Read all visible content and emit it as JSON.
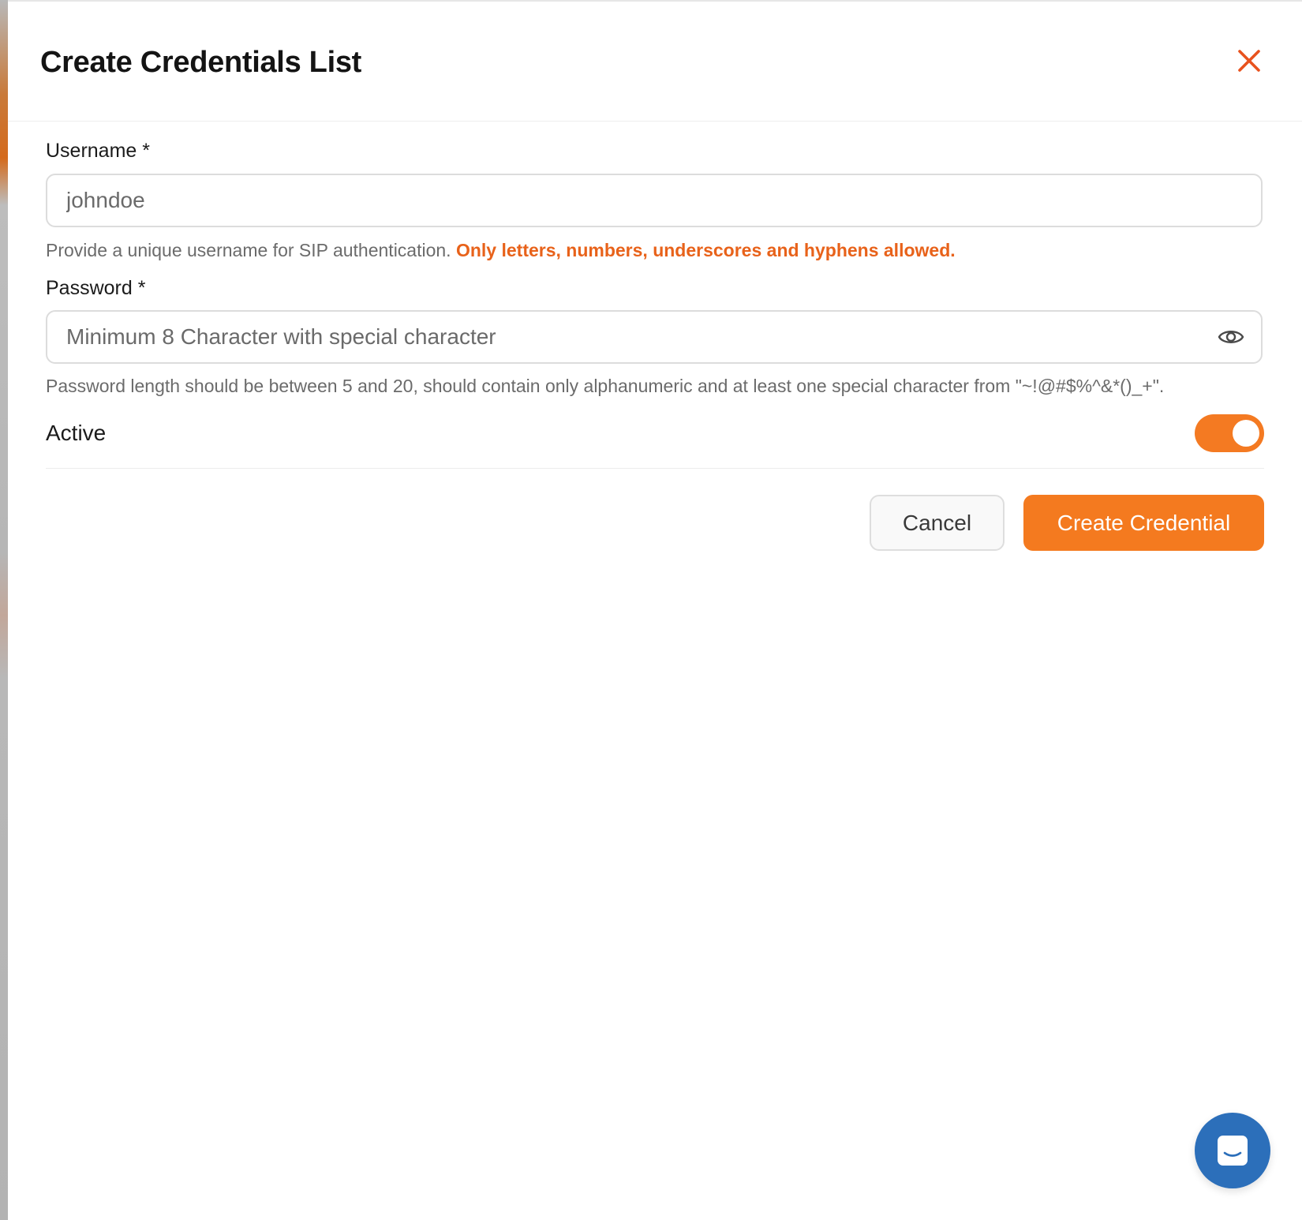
{
  "modal": {
    "title": "Create Credentials List"
  },
  "username": {
    "label": "Username *",
    "placeholder": "johndoe",
    "help": "Provide a unique username for SIP authentication.",
    "help_warning": "Only letters, numbers, underscores and hyphens allowed."
  },
  "password": {
    "label": "Password *",
    "placeholder": "Minimum 8 Character with special character",
    "help": "Password length should be between 5 and 20, should contain only alphanumeric and at least one special character from \"~!@#$%^&*()_+\"."
  },
  "active": {
    "label": "Active",
    "enabled": true
  },
  "actions": {
    "cancel_label": "Cancel",
    "create_label": "Create Credential"
  },
  "colors": {
    "accent": "#f47a1f",
    "close_icon": "#e8521e",
    "chat_launcher": "#2c6fba"
  },
  "icons": {
    "close": "close-icon",
    "eye": "eye-icon",
    "chat": "chat-icon"
  }
}
